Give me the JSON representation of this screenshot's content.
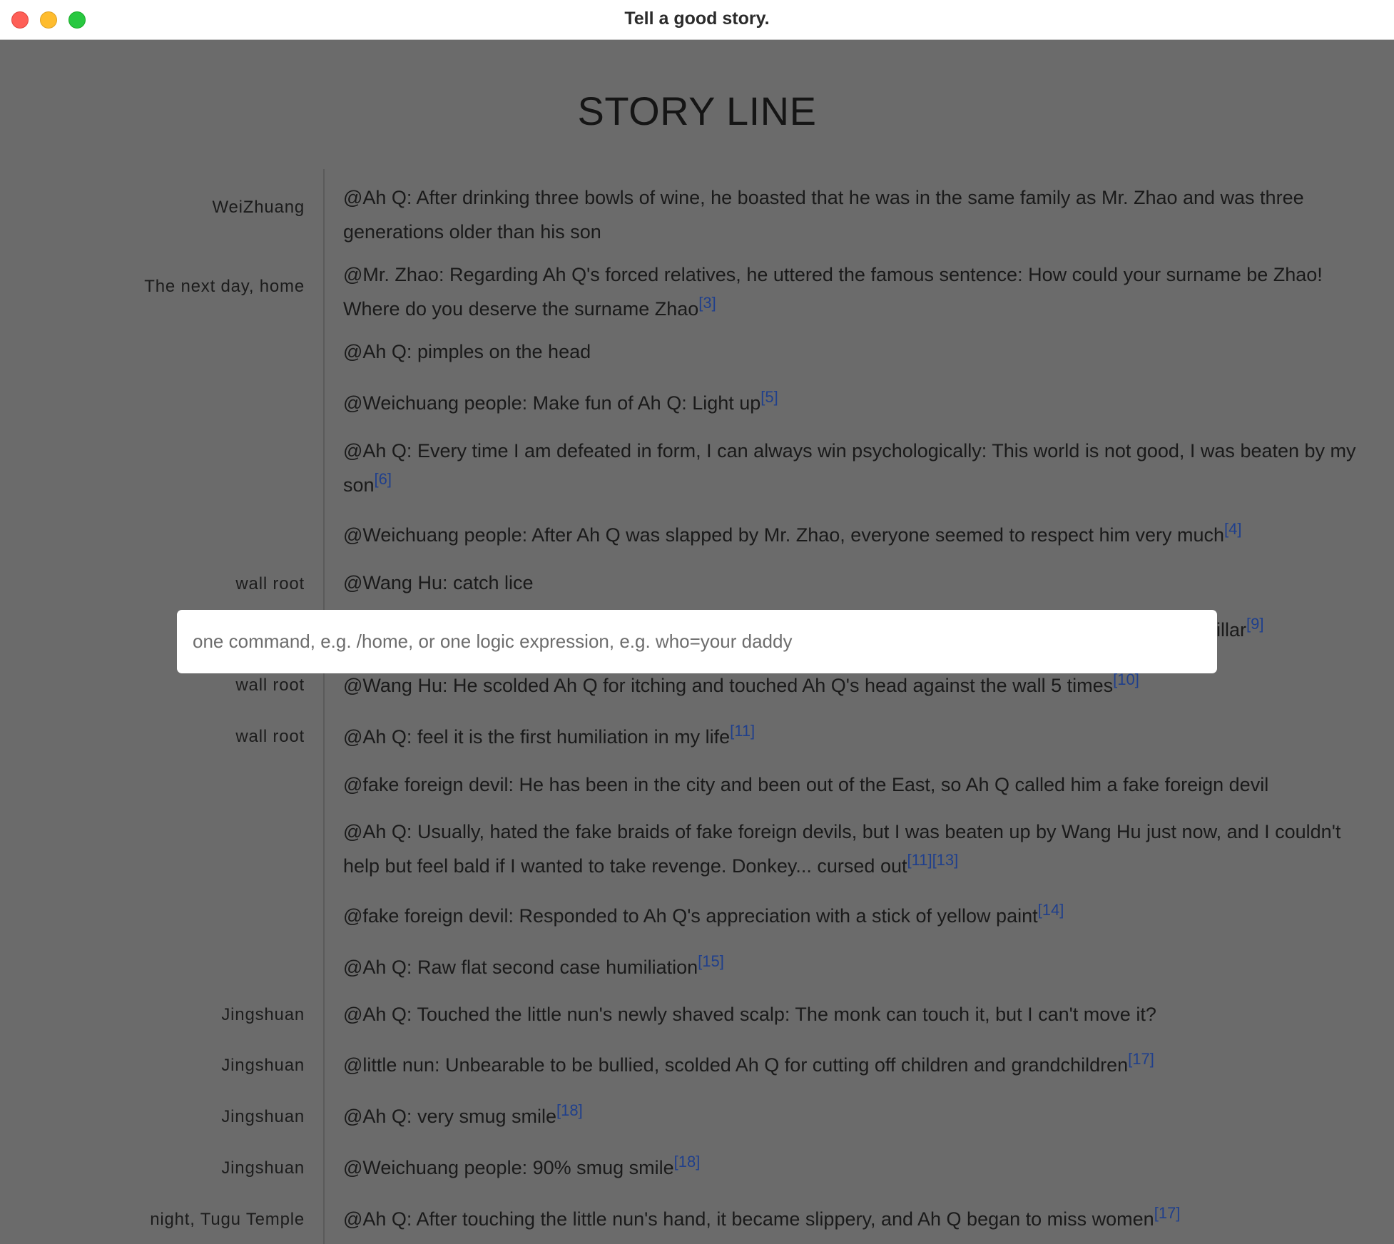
{
  "window": {
    "title": "Tell a good story."
  },
  "story": {
    "heading": "STORY LINE",
    "events": [
      {
        "location": "WeiZhuang",
        "text": "@Ah Q: After drinking three bowls of wine, he boasted that he was in the same family as Mr. Zhao and was three generations older than his son",
        "refs": []
      },
      {
        "location": "The next day, home",
        "text": "@Mr. Zhao: Regarding Ah Q's forced relatives, he uttered the famous sentence: How could your surname be Zhao! Where do you deserve the surname Zhao",
        "refs": [
          "[3]"
        ]
      },
      {
        "location": "",
        "text": "@Ah Q: pimples on the head",
        "refs": []
      },
      {
        "location": "",
        "text": "@Weichuang people: Make fun of Ah Q: Light up",
        "refs": [
          "[5]"
        ]
      },
      {
        "location": "",
        "text": "@Ah Q: Every time I am defeated in form, I can always win psychologically: This world is not good, I was beaten by my son",
        "refs": [
          "[6]"
        ]
      },
      {
        "location": "",
        "text": "@Weichuang people: After Ah Q was slapped by Mr. Zhao, everyone seemed to respect him very much",
        "refs": [
          "[4]"
        ]
      },
      {
        "location": "wall root",
        "text": "@Wang Hu: catch lice",
        "refs": []
      },
      {
        "location": "",
        "text": "erpillar",
        "refs": [
          "[9]"
        ]
      },
      {
        "location": "wall root",
        "text": "@Wang Hu: He scolded Ah Q for itching and touched Ah Q's head against the wall 5 times",
        "refs": [
          "[10]"
        ]
      },
      {
        "location": "wall root",
        "text": "@Ah Q: feel it is the first humiliation in my life",
        "refs": [
          "[11]"
        ]
      },
      {
        "location": "",
        "text": "@fake foreign devil: He has been in the city and been out of the East, so Ah Q called him a fake foreign devil",
        "refs": []
      },
      {
        "location": "",
        "text": "@Ah Q: Usually, hated the fake braids of fake foreign devils, but I was beaten up by Wang Hu just now, and I couldn't help but feel bald if I wanted to take revenge. Donkey... cursed out",
        "refs": [
          "[11]",
          "[13]"
        ]
      },
      {
        "location": "",
        "text": "@fake foreign devil: Responded to Ah Q's appreciation with a stick of yellow paint",
        "refs": [
          "[14]"
        ]
      },
      {
        "location": "",
        "text": "@Ah Q: Raw flat second case humiliation",
        "refs": [
          "[15]"
        ]
      },
      {
        "location": "Jingshuan",
        "text": "@Ah Q: Touched the little nun's newly shaved scalp: The monk can touch it, but I can't move it?",
        "refs": []
      },
      {
        "location": "Jingshuan",
        "text": "@little nun: Unbearable to be bullied, scolded Ah Q for cutting off children and grandchildren",
        "refs": [
          "[17]"
        ]
      },
      {
        "location": "Jingshuan",
        "text": "@Ah Q: very smug smile",
        "refs": [
          "[18]"
        ]
      },
      {
        "location": "Jingshuan",
        "text": "@Weichuang people: 90% smug smile",
        "refs": [
          "[18]"
        ]
      },
      {
        "location": "night, Tugu Temple",
        "text": "@Ah Q: After touching the little nun's hand, it became slippery, and Ah Q began to miss women",
        "refs": [
          "[17]"
        ]
      }
    ]
  },
  "command": {
    "placeholder": "one command, e.g. /home, or one logic expression, e.g. who=your daddy",
    "value": ""
  },
  "colors": {
    "background": "#6b6b6b",
    "reference_link": "#1f3f8c",
    "titlebar": "#ffffff"
  }
}
